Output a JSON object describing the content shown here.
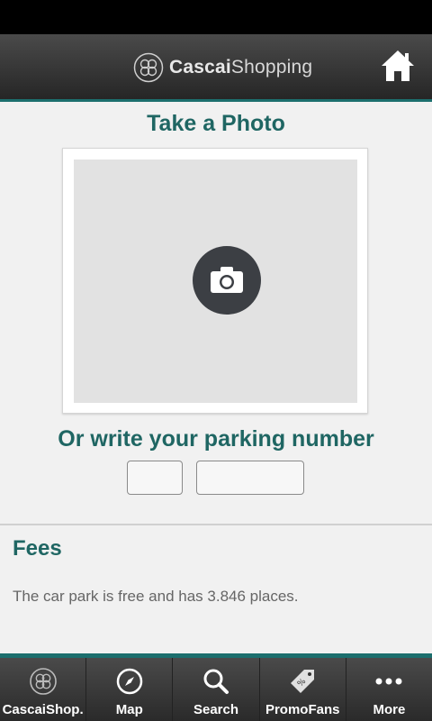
{
  "header": {
    "logo_bold": "Cascai",
    "logo_light": "Shopping",
    "home_icon": "home-icon"
  },
  "photo": {
    "title": "Take a Photo",
    "camera_icon": "camera-icon"
  },
  "parking": {
    "title": "Or write your parking number",
    "field1_value": "",
    "field2_value": ""
  },
  "fees": {
    "title": "Fees",
    "text": "The car park is free and has 3.846 places."
  },
  "tabs": [
    {
      "label": "CascaiShop.",
      "icon": "cascaishopping-logo-icon"
    },
    {
      "label": "Map",
      "icon": "compass-icon"
    },
    {
      "label": "Search",
      "icon": "search-icon"
    },
    {
      "label": "PromoFans",
      "icon": "price-tag-icon"
    },
    {
      "label": "More",
      "icon": "more-dots-icon"
    }
  ],
  "colors": {
    "accent": "#1c6f6e",
    "title_text": "#1f6663"
  }
}
